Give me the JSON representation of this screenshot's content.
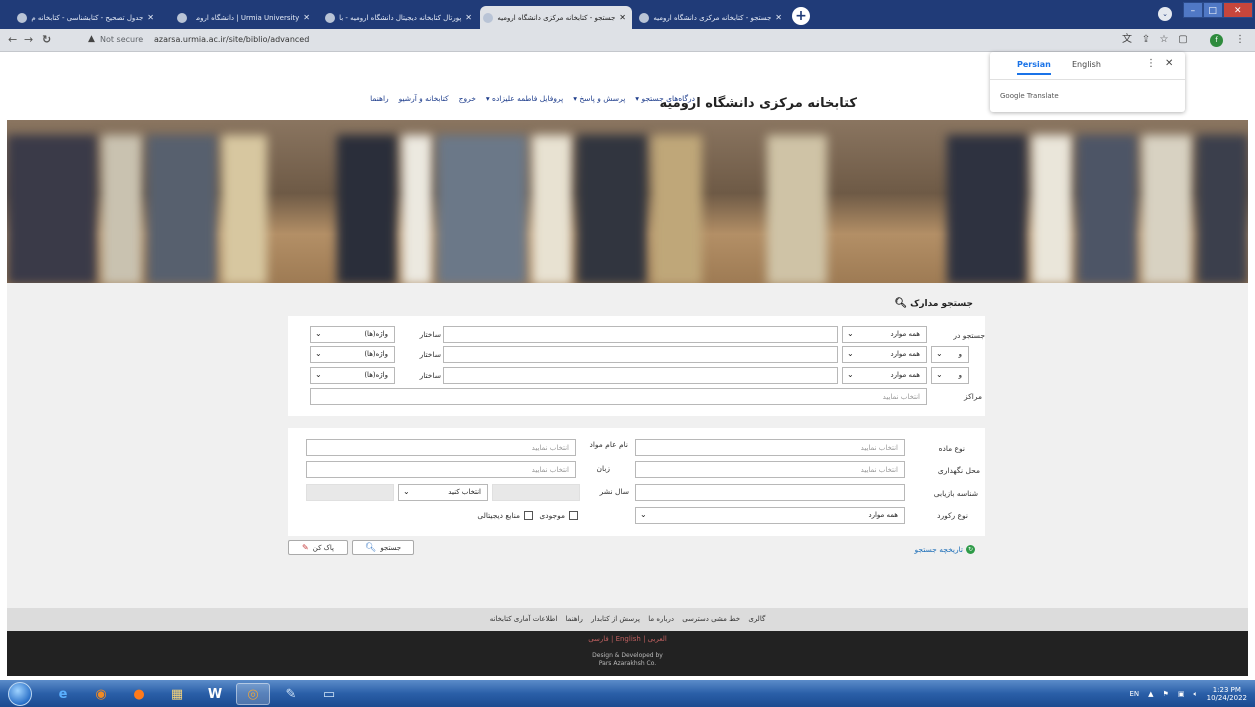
{
  "browser": {
    "tabs": [
      {
        "title": "جدول تصحیح - کتابشناسی - کتابخانه م"
      },
      {
        "title": "Urmia University | دانشگاه ارومیه"
      },
      {
        "title": "پورتال کتابخانه دیجیتال دانشگاه ارومیه - با"
      },
      {
        "title": "جستجو - کتابخانه مرکزی دانشگاه ارومیه"
      },
      {
        "title": "جستجو - کتابخانه مرکزی دانشگاه ارومیه"
      }
    ],
    "first_tab_title": "جدول تصحیح - کتابشناسی - کتابخانه م",
    "security_label": "Not secure",
    "url": "azarsa.urmia.ac.ir/site/biblio/advanced",
    "profile_initial": "f"
  },
  "translate": {
    "lang1": "Persian",
    "lang2": "English",
    "provider": "Google Translate"
  },
  "site": {
    "title": "کتابخانه مرکزی دانشگاه ارومیه",
    "nav": [
      "درگاه‌های جستجو ▾",
      "پرسش و پاسخ ▾",
      "پروفایل فاطمه علیزاده ▾",
      "خروج",
      "کتابخانه و آرشیو",
      "راهنما"
    ]
  },
  "search": {
    "title": "جستجو مدارک",
    "search_in_label": "جستجو در",
    "all_items": "همه موارد",
    "and": "و",
    "structure_label": "ساختار",
    "words": "واژه(ها)",
    "centers_label": "مراکز",
    "select_placeholder": "انتخاب نمایید",
    "material_type": "نوع ماده",
    "general_material": "نام عام مواد",
    "location": "محل نگهداری",
    "language": "زبان",
    "retrieval_id": "شناسه بازیابی",
    "pub_year": "سال نشر",
    "select_do": "انتخاب کنید",
    "record_type": "نوع رکورد",
    "available": "موجودی",
    "digital": "منابع دیجیتالی",
    "history": "تاریخچه جستجو",
    "search_btn": "جستجو",
    "clear_btn": "پاک کن"
  },
  "footer": {
    "links": [
      "گالری",
      "خط مشی دسترسی",
      "درباره ما",
      "پرسش از کتابدار",
      "راهنما",
      "اطلاعات آماری کتابخانه"
    ],
    "langs": "فارسی | English | العربی",
    "credit1": "Design & Developed by",
    "credit2": "Pars Azarakhsh Co."
  },
  "taskbar": {
    "lang": "EN",
    "time": "1:23 PM",
    "date": "10/24/2022"
  }
}
